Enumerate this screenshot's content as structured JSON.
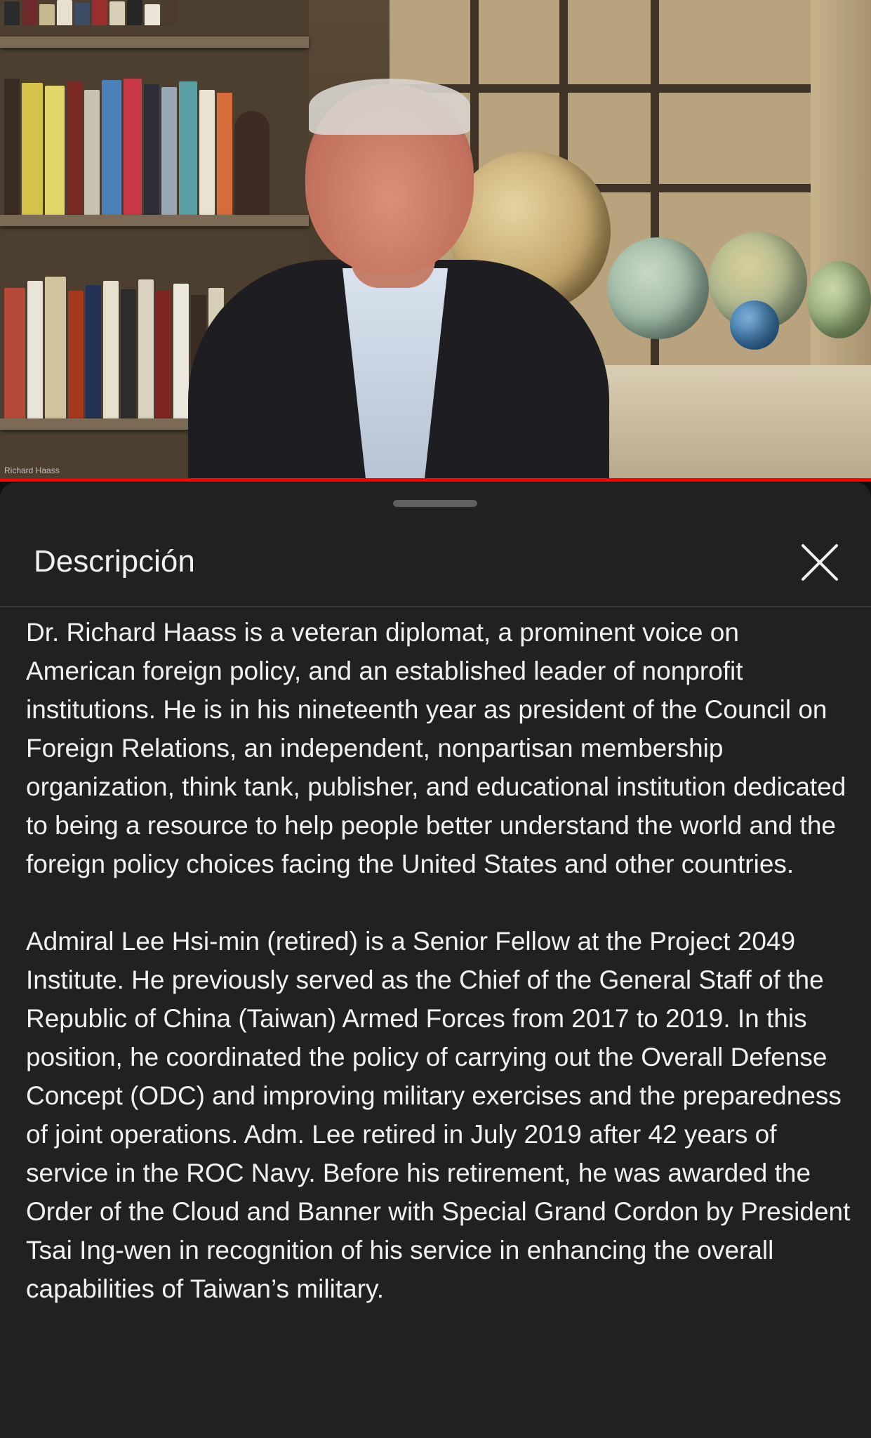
{
  "video": {
    "overlay_name": "Richard Haass",
    "progress_fraction": 1.0,
    "progress_color": "#ff0000"
  },
  "panel": {
    "title": "Descripción",
    "close_icon": "close-icon",
    "paragraphs": [
      "Dr. Richard Haass is a veteran diplomat, a prominent voice on American foreign policy, and an established leader of nonprofit institutions. He is in his nineteenth year as president of the Council on Foreign Relations, an independent, nonpartisan membership organization, think tank, publisher, and educational institution dedicated to being a resource to help people better understand the world and the foreign policy choices facing the United States and other countries.",
      "Admiral Lee Hsi-min (retired) is a Senior Fellow at the Project 2049 Institute. He previously served as the Chief of the General Staff of the Republic of China (Taiwan) Armed Forces from 2017 to 2019. In this position, he coordinated the policy of carrying out the Overall Defense Concept (ODC) and improving military exercises and the preparedness of joint operations. Adm. Lee retired in July 2019 after 42 years of service in the ROC Navy. Before his retirement, he was awarded the Order of the Cloud and Banner with Special Grand Cordon by President Tsai Ing-wen in recognition of his service in enhancing the overall capabilities of Taiwan’s military."
    ]
  },
  "colors": {
    "panel_bg": "#212121",
    "text": "#f1f1f1",
    "accent": "#ff0000"
  }
}
